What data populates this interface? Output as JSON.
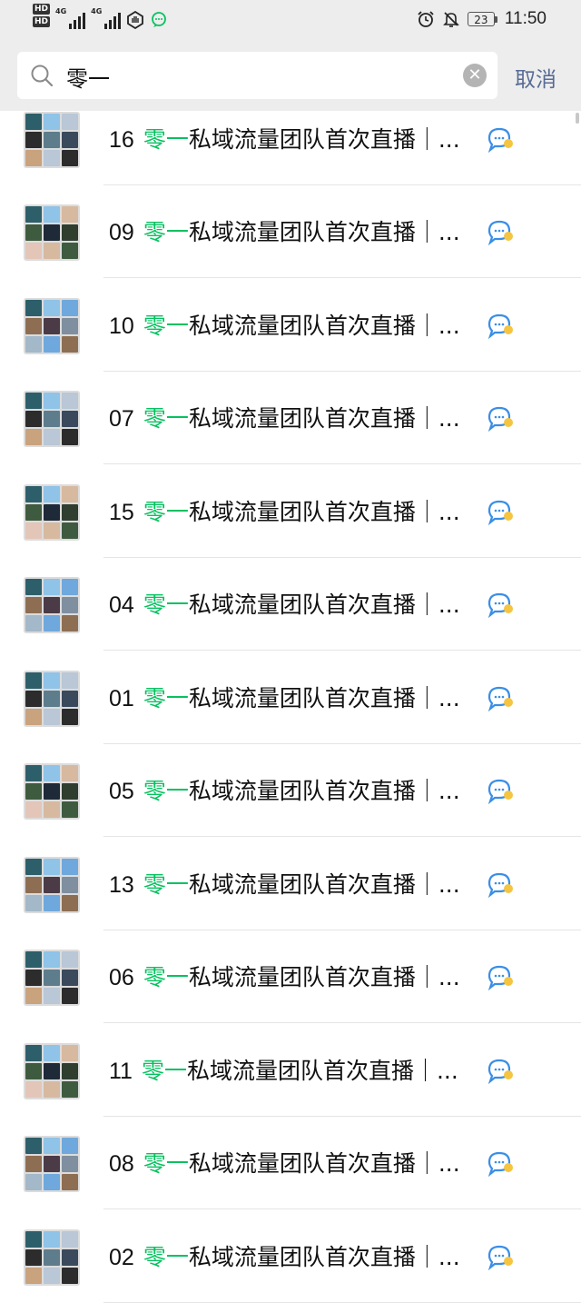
{
  "status_bar": {
    "hd1": "HD",
    "hd2": "HD",
    "net1": "4G",
    "net2": "4G",
    "battery": "23",
    "time": "11:50"
  },
  "search": {
    "query": "零一",
    "cancel_label": "取消"
  },
  "colors": {
    "highlight": "#07c160",
    "cancel": "#576b95",
    "header_bg": "#ededed"
  },
  "results": [
    {
      "num": "16",
      "keyword": "零一",
      "rest": "私域流量团队首次直播｜..."
    },
    {
      "num": "09",
      "keyword": "零一",
      "rest": "私域流量团队首次直播｜..."
    },
    {
      "num": "10",
      "keyword": "零一",
      "rest": "私域流量团队首次直播｜..."
    },
    {
      "num": "07",
      "keyword": "零一",
      "rest": "私域流量团队首次直播｜..."
    },
    {
      "num": "15",
      "keyword": "零一",
      "rest": "私域流量团队首次直播｜..."
    },
    {
      "num": "04",
      "keyword": "零一",
      "rest": "私域流量团队首次直播｜..."
    },
    {
      "num": "01",
      "keyword": "零一",
      "rest": "私域流量团队首次直播｜..."
    },
    {
      "num": "05",
      "keyword": "零一",
      "rest": "私域流量团队首次直播｜..."
    },
    {
      "num": "13",
      "keyword": "零一",
      "rest": "私域流量团队首次直播｜..."
    },
    {
      "num": "06",
      "keyword": "零一",
      "rest": "私域流量团队首次直播｜..."
    },
    {
      "num": "11",
      "keyword": "零一",
      "rest": "私域流量团队首次直播｜..."
    },
    {
      "num": "08",
      "keyword": "零一",
      "rest": "私域流量团队首次直播｜..."
    },
    {
      "num": "02",
      "keyword": "零一",
      "rest": "私域流量团队首次直播｜..."
    }
  ],
  "icons": {
    "search": "search-icon",
    "clear": "clear-icon",
    "group_chat": "group-chat-icon",
    "alarm": "alarm-icon",
    "mute": "bell-off-icon"
  }
}
